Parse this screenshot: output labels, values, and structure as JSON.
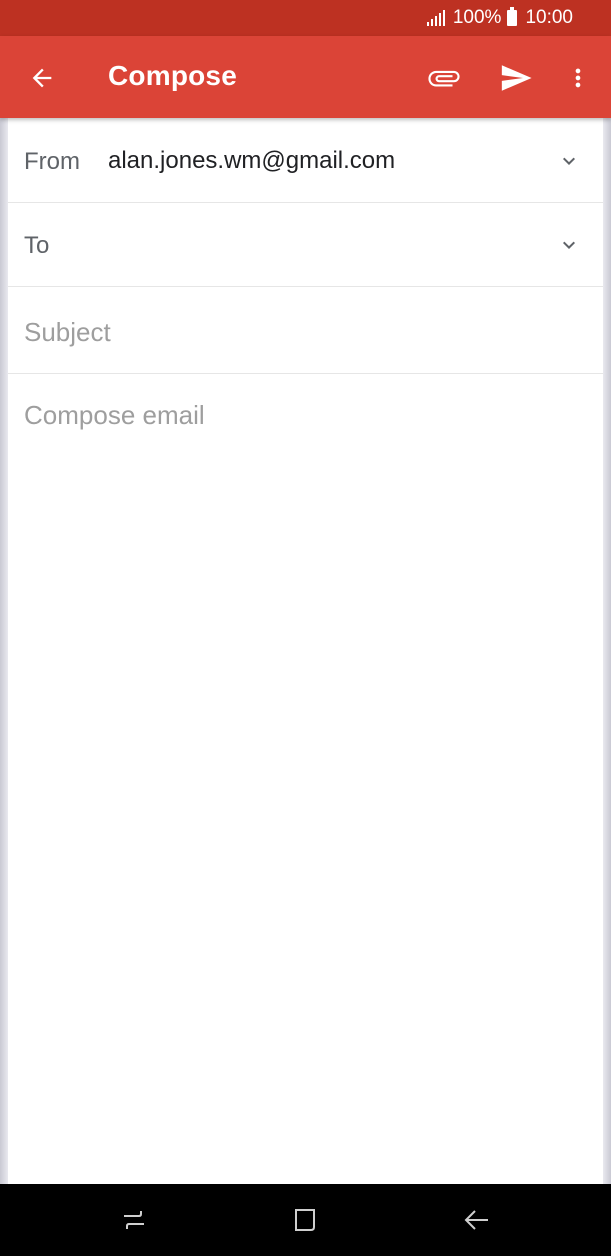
{
  "status_bar": {
    "battery_percent": "100%",
    "time": "10:00"
  },
  "app_bar": {
    "title": "Compose",
    "icons": [
      "back-arrow-icon",
      "attachment-icon",
      "send-icon",
      "more-vert-icon"
    ]
  },
  "form": {
    "from_label": "From",
    "from_value": "alan.jones.wm@gmail.com",
    "to_label": "To",
    "subject_placeholder": "Subject",
    "body_placeholder": "Compose email"
  },
  "nav_bar": {
    "icons": [
      "recents-icon",
      "home-icon",
      "back-icon"
    ]
  },
  "colors": {
    "status_bar": "#bd3122",
    "app_bar": "#db4437",
    "text_primary": "#202124",
    "text_secondary": "#5f6368",
    "placeholder": "#9e9e9e"
  }
}
